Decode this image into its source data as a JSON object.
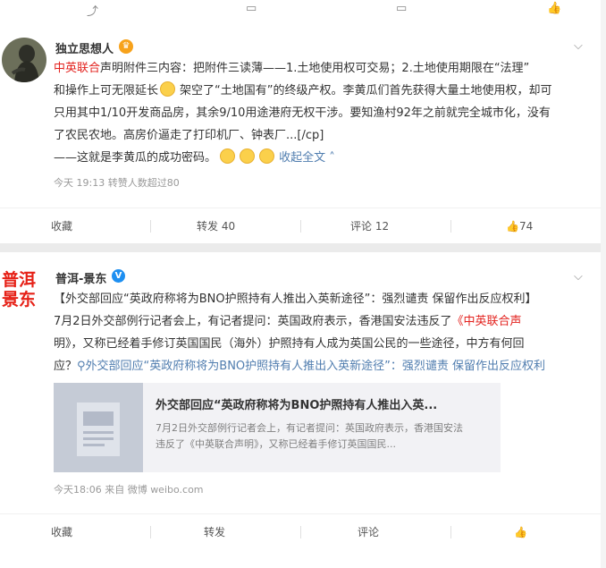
{
  "post1": {
    "username": "独立思想人",
    "text": {
      "s1": "中英联合",
      "s2": "声明附件三内容：把附件三读薄——1.土地使用权可交易；2.土地使用期限在“法理”",
      "s3": "和操作上可无限延长",
      "s4": "架空了“土地国有”的终级产权。李黄瓜们首先获得大量土地使用权，却可",
      "s5": "只用其中1/10开发商品房，其余9/10用途港府无权干涉。要知渔村92年之前就完全城市化，没有",
      "s6": "了农民农地。高房价逼走了打印机厂、钟表厂...[/cp]",
      "s7": "——这就是李黄瓜的成功密码。",
      "collapse": "收起全文"
    },
    "meta": "今天 19:13 转赞人数超过80",
    "actions": {
      "collect": "收藏",
      "repost": "转发 40",
      "comment": "评论 12",
      "like": "74"
    }
  },
  "post2": {
    "logo_text": [
      "普洱",
      "景东"
    ],
    "username": "普洱-景东",
    "text": {
      "l1": "【外交部回应“英政府称将为BNO护照持有人推出入英新途径”：强烈谴责 保留作出反应权利】",
      "l2a": "7月2日外交部例行记者会上，有记者提问：英国政府表示，香港国安法违反了",
      "l2b": "《中英联合声",
      "l3": "明》，又称已经着手修订英国国民（海外）护照持有人成为英国公民的一些途径，中方有何回",
      "l4a": "应？",
      "l4b": "外交部回应“英政府称将为BNO护照持有人推出入英新途径”：强烈谴责 保留作出反应权利"
    },
    "link_card": {
      "title": "外交部回应“英政府称将为BNO护照持有人推出入英...",
      "desc1": "7月2日外交部例行记者会上，有记者提问：英国政府表示，香港国安法",
      "desc2": "违反了《中英联合声明》，又称已经着手修订英国国民..."
    },
    "meta": "今天18:06 来自 微博 weibo.com",
    "actions": {
      "collect": "收藏",
      "repost": "转发",
      "comment": "评论"
    }
  },
  "colors": {
    "red": "#e3221e",
    "link_blue": "#507daf",
    "meta_gray": "#999999"
  }
}
